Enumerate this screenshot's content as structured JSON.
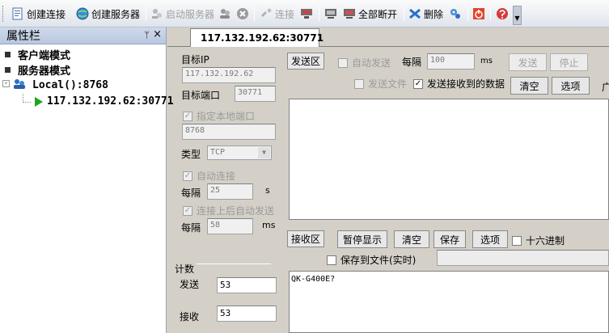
{
  "toolbar": {
    "create_connection": "创建连接",
    "create_server": "创建服务器",
    "start_server": "启动服务器",
    "connect": "连接",
    "disconnect_all": "全部断开",
    "delete": "删除"
  },
  "left_panel": {
    "title": "属性栏",
    "pin": "ᛘ",
    "close": "×",
    "tree": {
      "client_mode": "客户端模式",
      "server_mode": "服务器模式",
      "local": "Local():8768",
      "connection": "117.132.192.62:30771"
    }
  },
  "tab": {
    "label": "117.132.192.62:30771"
  },
  "settings": {
    "target_ip_label": "目标IP",
    "target_ip": "117.132.192.62",
    "target_port_label": "目标端口",
    "target_port": "30771",
    "specify_local_port": "指定本地端口",
    "local_port": "8768",
    "type_label": "类型",
    "type_value": "TCP",
    "auto_connect": "自动连接",
    "every_label_1": "每隔",
    "every_value_1": "25",
    "unit_s": "s",
    "auto_send_after_connect": "连接上后自动发送",
    "every_label_2": "每隔",
    "every_value_2": "58",
    "unit_ms": "ms",
    "count_title": "计数",
    "send_label": "发送",
    "send_count": "53",
    "recv_label": "接收",
    "recv_count": "53"
  },
  "send_area": {
    "label": "发送区",
    "auto_send": "自动发送",
    "every": "每隔",
    "interval": "100",
    "unit": "ms",
    "send_btn": "发送",
    "stop_btn": "停止",
    "send_file": "发送文件",
    "send_received": "发送接收到的数据",
    "clear_btn": "清空",
    "options_btn": "选项",
    "broadcast_partial": "广"
  },
  "recv_area": {
    "label": "接收区",
    "pause_btn": "暂停显示",
    "clear_btn": "清空",
    "save_btn": "保存",
    "options_btn": "选项",
    "hex": "十六进制",
    "save_to_file": "保存到文件(实时)",
    "content": "QK-G400E?"
  }
}
